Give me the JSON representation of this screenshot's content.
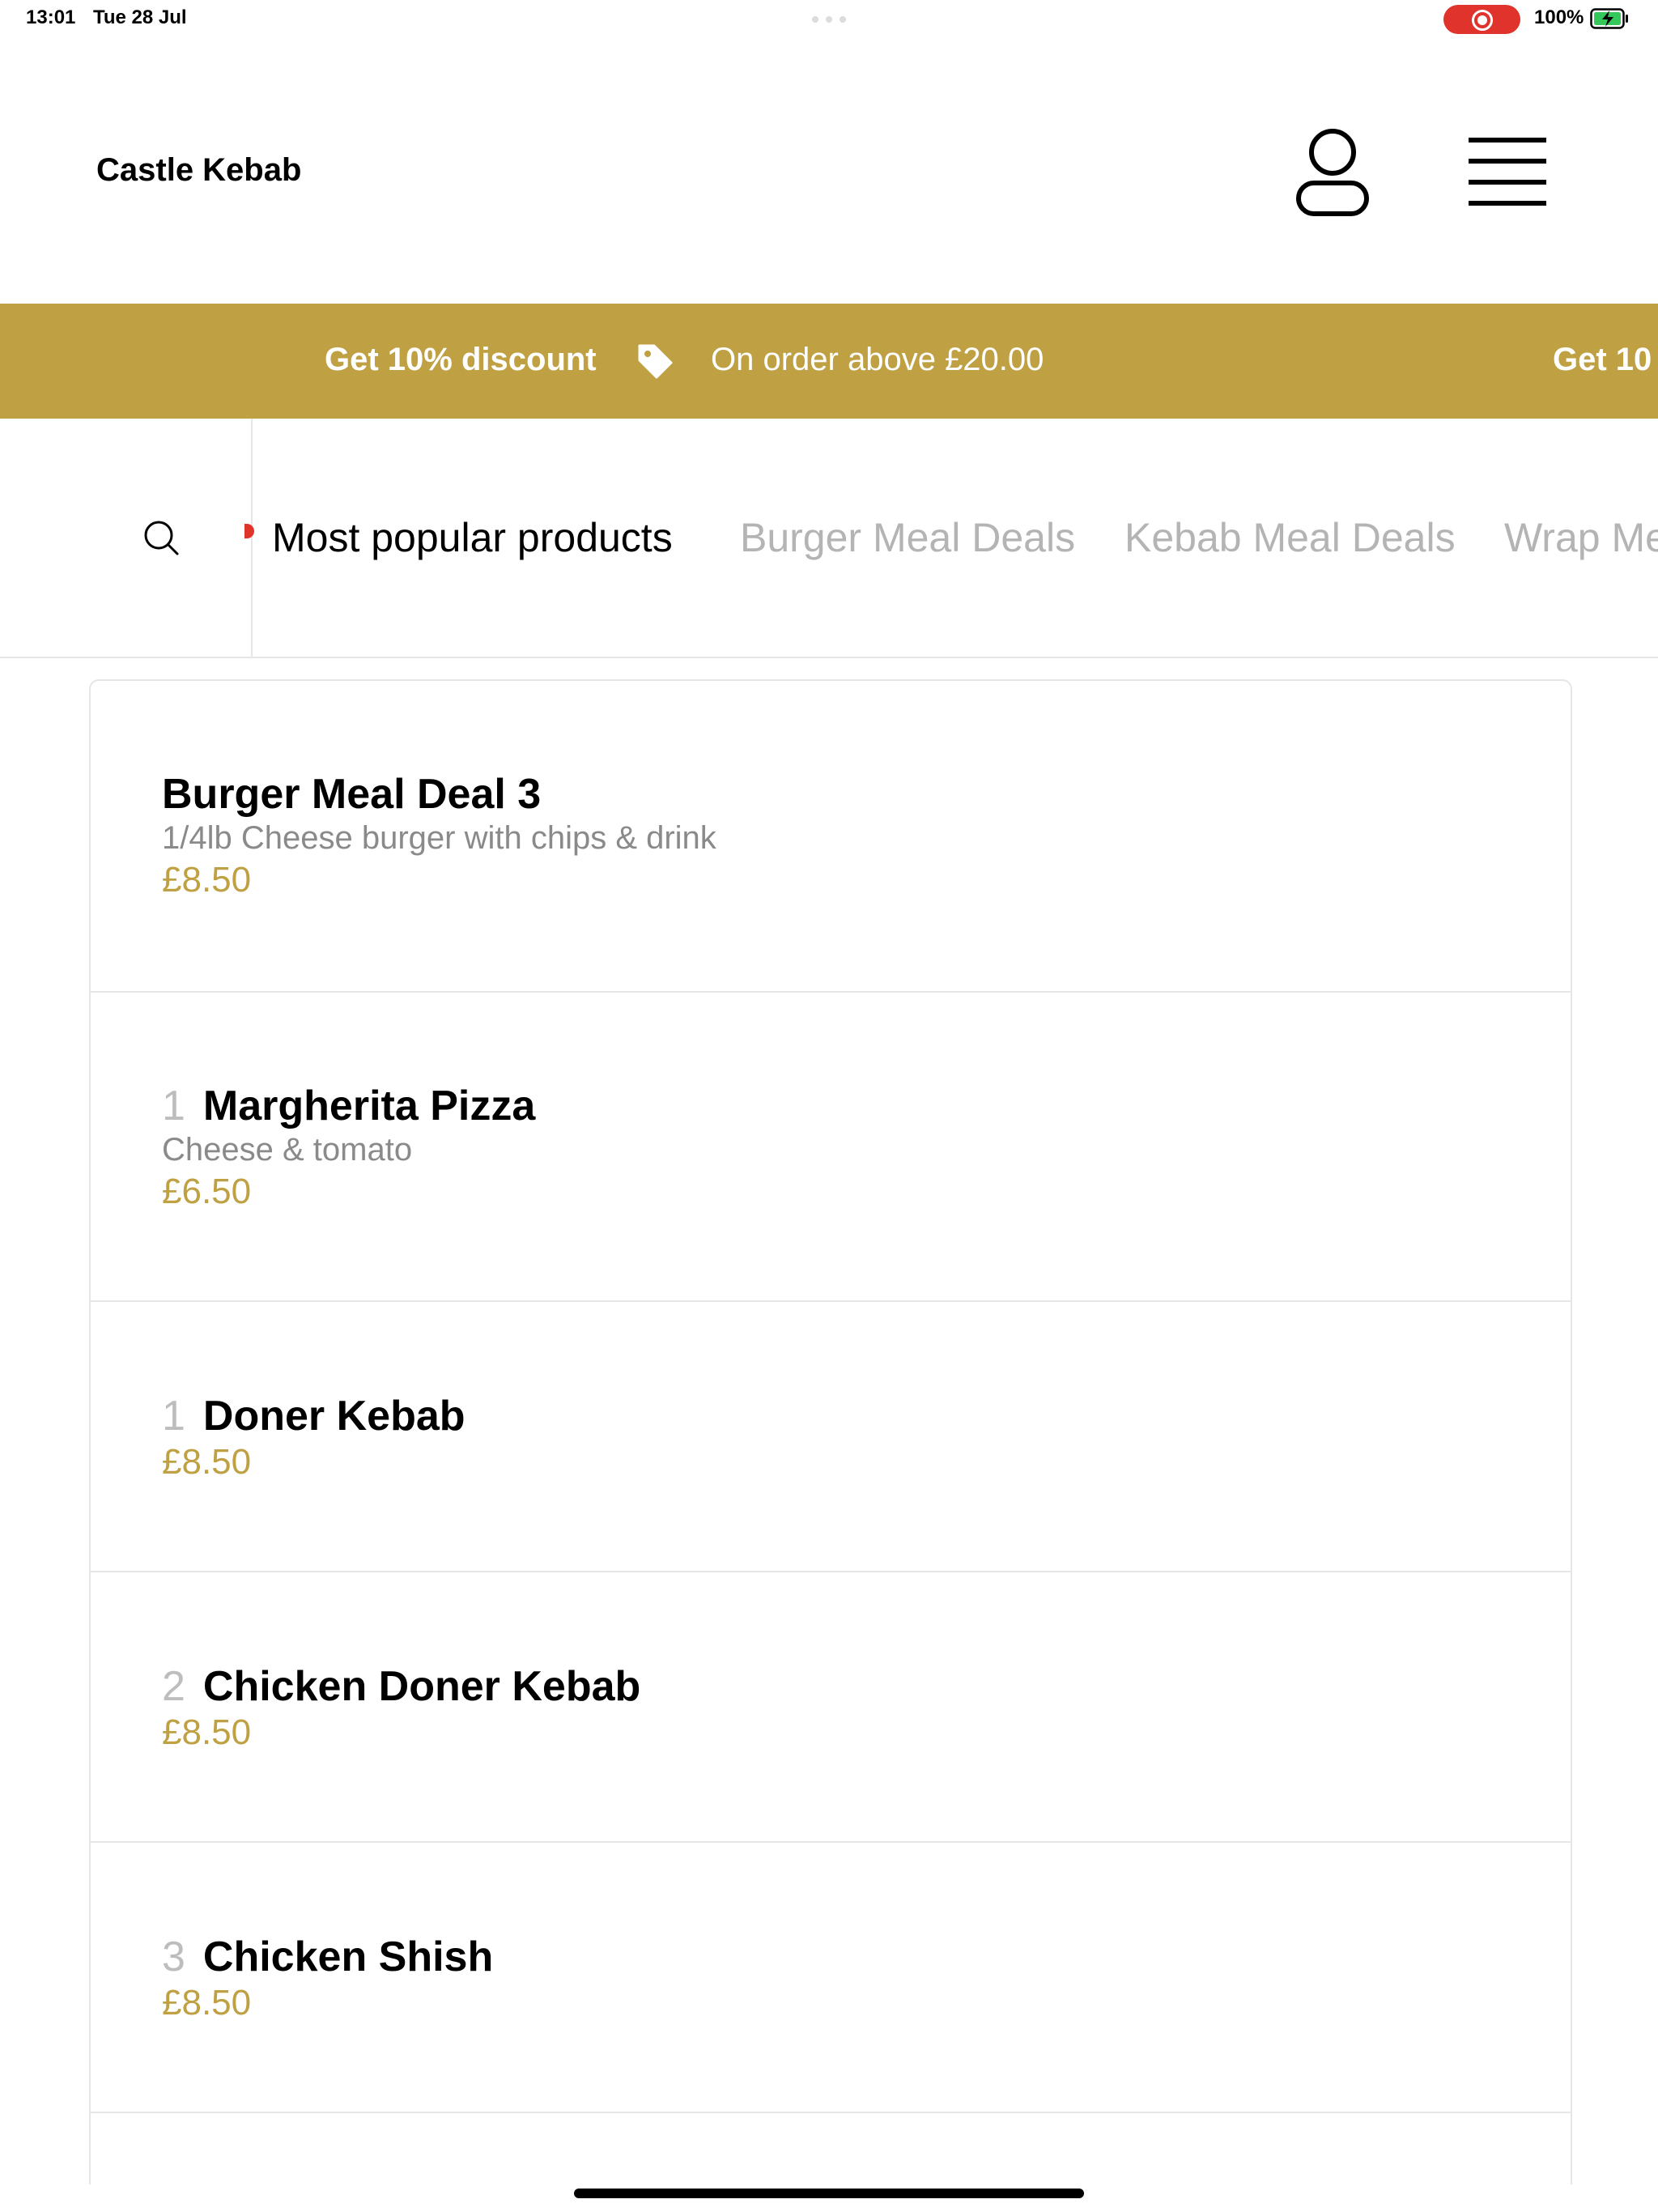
{
  "status_bar": {
    "time": "13:01",
    "date": "Tue 28 Jul",
    "battery": "100%"
  },
  "header": {
    "brand": "Castle Kebab",
    "user_icon": "user-icon",
    "menu_icon": "hamburger-menu-icon"
  },
  "promo": {
    "title": "Get 10% discount",
    "subtitle": "On order above £20.00",
    "title_repeat": "Get 10",
    "icon": "tag-icon",
    "color": "#bfa144"
  },
  "categories": {
    "search_icon": "search-icon",
    "tabs": [
      {
        "label": "Most popular products",
        "active": true
      },
      {
        "label": "Burger Meal Deals",
        "active": false
      },
      {
        "label": "Kebab Meal Deals",
        "active": false
      },
      {
        "label": "Wrap Me",
        "active": false
      }
    ]
  },
  "products": [
    {
      "number": "",
      "name": "Burger Meal Deal 3",
      "description": "1/4lb Cheese burger with chips & drink",
      "price": "£8.50"
    },
    {
      "number": "1",
      "name": "Margherita Pizza",
      "description": "Cheese & tomato",
      "price": "£6.50"
    },
    {
      "number": "1",
      "name": "Doner Kebab",
      "description": "",
      "price": "£8.50"
    },
    {
      "number": "2",
      "name": "Chicken Doner Kebab",
      "description": "",
      "price": "£8.50"
    },
    {
      "number": "3",
      "name": "Chicken Shish",
      "description": "",
      "price": "£8.50"
    }
  ],
  "colors": {
    "accent": "#bfa144",
    "record": "#e0332c",
    "battery": "#34c759"
  }
}
